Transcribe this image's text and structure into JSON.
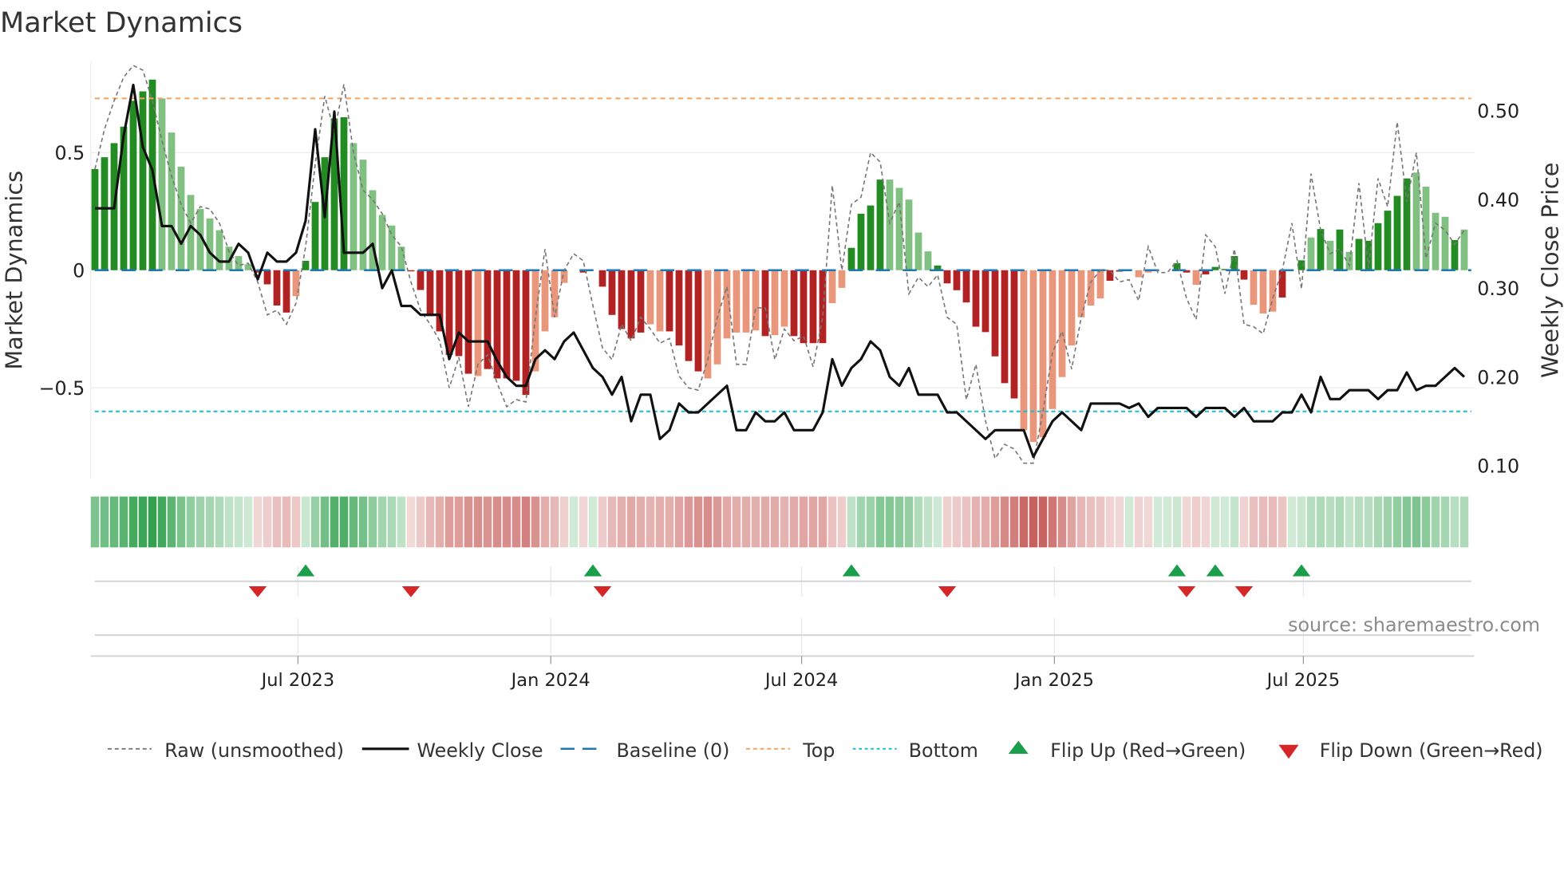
{
  "title": "Market Dynamics",
  "source": "source: sharemaestro.com",
  "chart_data": {
    "type": "bar",
    "title": "Market Dynamics",
    "ylabel": "Market Dynamics",
    "y2label": "Weekly Close Price",
    "ylim": [
      -0.886,
      0.886
    ],
    "y2lim": [
      0.085,
      0.555
    ],
    "yticks": [
      {
        "v": 0.5,
        "label": "0.5"
      },
      {
        "v": 0,
        "label": "0"
      },
      {
        "v": -0.5,
        "label": "−0.5"
      }
    ],
    "y2ticks": [
      {
        "v": 0.5,
        "label": "0.50"
      },
      {
        "v": 0.4,
        "label": "0.40"
      },
      {
        "v": 0.3,
        "label": "0.30"
      },
      {
        "v": 0.2,
        "label": "0.20"
      },
      {
        "v": 0.1,
        "label": "0.10"
      }
    ],
    "xticks": [
      {
        "week": 22.2,
        "label": "Jul 2023"
      },
      {
        "week": 48.6,
        "label": "Jan 2024"
      },
      {
        "week": 74.8,
        "label": "Jul 2024"
      },
      {
        "week": 101.2,
        "label": "Jan 2025"
      },
      {
        "week": 127.2,
        "label": "Jul 2025"
      }
    ],
    "top": 0.73,
    "bottom": -0.6,
    "baseline": 0,
    "values": [
      0.43,
      0.48,
      0.54,
      0.61,
      0.72,
      0.76,
      0.81,
      0.73,
      0.585,
      0.44,
      0.32,
      0.26,
      0.22,
      0.17,
      0.1,
      0.06,
      0.025,
      -0.01,
      -0.06,
      -0.15,
      -0.18,
      -0.11,
      0.04,
      0.29,
      0.48,
      0.645,
      0.65,
      0.54,
      0.47,
      0.34,
      0.235,
      0.19,
      0.1,
      -0.005,
      -0.084,
      -0.195,
      -0.26,
      -0.36,
      -0.365,
      -0.44,
      -0.45,
      -0.42,
      -0.46,
      -0.46,
      -0.47,
      -0.53,
      -0.43,
      -0.26,
      -0.2,
      -0.054,
      0,
      -0.01,
      0,
      -0.07,
      -0.19,
      -0.25,
      -0.29,
      -0.265,
      -0.23,
      -0.26,
      -0.26,
      -0.32,
      -0.386,
      -0.43,
      -0.46,
      -0.4,
      -0.29,
      -0.265,
      -0.265,
      -0.256,
      -0.28,
      -0.276,
      -0.24,
      -0.28,
      -0.31,
      -0.31,
      -0.31,
      -0.14,
      -0.075,
      0.095,
      0.24,
      0.275,
      0.385,
      0.385,
      0.35,
      0.3,
      0.16,
      0.08,
      0.02,
      -0.056,
      -0.085,
      -0.137,
      -0.24,
      -0.263,
      -0.366,
      -0.48,
      -0.545,
      -0.68,
      -0.73,
      -0.71,
      -0.59,
      -0.454,
      -0.32,
      -0.2,
      -0.15,
      -0.12,
      -0.045,
      -0.006,
      0,
      -0.03,
      -0.01,
      0,
      0,
      0.03,
      -0.01,
      -0.062,
      -0.018,
      0.014,
      0.005,
      0.06,
      -0.04,
      -0.147,
      -0.184,
      -0.176,
      -0.116,
      0,
      0.042,
      0.139,
      0.175,
      0.125,
      0.173,
      0.078,
      0.133,
      0.125,
      0.2,
      0.253,
      0.316,
      0.39,
      0.415,
      0.355,
      0.244,
      0.227,
      0.128,
      0.173
    ],
    "strength": "dddddddllllllllllddddldddddlllllldddddddldddddllllldddddddllddddlllllldllddddllddddllllldddddddddlllllllllddlllddddldddddllldddldldlddddddlllld",
    "raw": [
      0.43,
      0.6,
      0.72,
      0.82,
      0.87,
      0.85,
      0.72,
      0.55,
      0.4,
      0.28,
      0.2,
      0.27,
      0.26,
      0.2,
      0.08,
      0.02,
      0.03,
      -0.05,
      -0.19,
      -0.17,
      -0.23,
      -0.14,
      0.1,
      0.45,
      0.74,
      0.59,
      0.79,
      0.5,
      0.34,
      0.3,
      0.24,
      0.15,
      0.1,
      -0.05,
      -0.17,
      -0.23,
      -0.3,
      -0.5,
      -0.37,
      -0.58,
      -0.4,
      -0.36,
      -0.48,
      -0.58,
      -0.55,
      -0.56,
      -0.2,
      0.09,
      -0.2,
      0.0,
      0.07,
      0.04,
      -0.15,
      -0.33,
      -0.38,
      -0.23,
      -0.3,
      -0.2,
      -0.25,
      -0.31,
      -0.29,
      -0.45,
      -0.5,
      -0.51,
      -0.38,
      -0.2,
      -0.07,
      -0.4,
      -0.4,
      -0.16,
      -0.16,
      -0.38,
      -0.25,
      -0.3,
      -0.28,
      -0.41,
      -0.2,
      0.36,
      0.0,
      0.28,
      0.31,
      0.5,
      0.46,
      0.2,
      0.29,
      -0.1,
      -0.03,
      -0.07,
      -0.02,
      -0.2,
      -0.23,
      -0.55,
      -0.4,
      -0.64,
      -0.8,
      -0.74,
      -0.76,
      -0.82,
      -0.82,
      -0.6,
      -0.35,
      -0.26,
      -0.42,
      -0.2,
      -0.05,
      0.0,
      0.0,
      -0.05,
      -0.04,
      -0.13,
      0.1,
      -0.01,
      -0.01,
      0.04,
      -0.12,
      -0.21,
      0.15,
      0.1,
      -0.1,
      0.09,
      -0.23,
      -0.24,
      -0.27,
      -0.12,
      0.0,
      0.2,
      -0.08,
      0.41,
      0.17,
      0.07,
      0.09,
      0.02,
      0.37,
      0.01,
      0.39,
      0.27,
      0.63,
      0.29,
      0.5,
      0.05,
      0.2,
      0.17,
      0.11,
      0.17
    ],
    "close": [
      0.39,
      0.39,
      0.39,
      0.472,
      0.529,
      0.459,
      0.433,
      0.37,
      0.37,
      0.35,
      0.37,
      0.36,
      0.34,
      0.33,
      0.33,
      0.35,
      0.34,
      0.31,
      0.34,
      0.33,
      0.33,
      0.34,
      0.376,
      0.479,
      0.38,
      0.499,
      0.34,
      0.34,
      0.34,
      0.35,
      0.3,
      0.32,
      0.28,
      0.28,
      0.27,
      0.27,
      0.27,
      0.22,
      0.25,
      0.24,
      0.24,
      0.24,
      0.218,
      0.2,
      0.19,
      0.19,
      0.22,
      0.23,
      0.22,
      0.24,
      0.25,
      0.23,
      0.21,
      0.2,
      0.18,
      0.2,
      0.15,
      0.18,
      0.18,
      0.13,
      0.14,
      0.17,
      0.16,
      0.16,
      0.17,
      0.18,
      0.19,
      0.14,
      0.14,
      0.16,
      0.15,
      0.15,
      0.16,
      0.14,
      0.14,
      0.14,
      0.16,
      0.22,
      0.19,
      0.21,
      0.22,
      0.24,
      0.23,
      0.2,
      0.19,
      0.21,
      0.18,
      0.18,
      0.18,
      0.16,
      0.16,
      0.15,
      0.14,
      0.13,
      0.14,
      0.14,
      0.14,
      0.14,
      0.11,
      0.13,
      0.15,
      0.16,
      0.15,
      0.14,
      0.17,
      0.17,
      0.17,
      0.17,
      0.165,
      0.17,
      0.155,
      0.165,
      0.165,
      0.165,
      0.165,
      0.155,
      0.165,
      0.165,
      0.165,
      0.155,
      0.165,
      0.15,
      0.15,
      0.15,
      0.16,
      0.16,
      0.18,
      0.16,
      0.2,
      0.175,
      0.175,
      0.185,
      0.185,
      0.185,
      0.175,
      0.185,
      0.185,
      0.205,
      0.185,
      0.19,
      0.19,
      0.2,
      0.21,
      0.2
    ],
    "flip_up_weeks": [
      23,
      53,
      80,
      114,
      118,
      127
    ],
    "flip_down_weeks": [
      18,
      34,
      54,
      90,
      115,
      121
    ],
    "legend": [
      {
        "key": "raw",
        "label": "Raw (unsmoothed)"
      },
      {
        "key": "close",
        "label": "Weekly Close"
      },
      {
        "key": "baseline",
        "label": "Baseline (0)"
      },
      {
        "key": "top",
        "label": "Top"
      },
      {
        "key": "bottom",
        "label": "Bottom"
      },
      {
        "key": "flip_up",
        "label": "Flip Up (Red→Green)"
      },
      {
        "key": "flip_down",
        "label": "Flip Down (Green→Red)"
      }
    ],
    "legend_placement": "bottom",
    "colors": {
      "pos_strong": "#228b22",
      "pos_fading": "#80c080",
      "neg_strong": "#b22222",
      "neg_fading": "#e9967a",
      "raw": "#777777",
      "close": "#111111",
      "baseline": "#1f77b4",
      "top": "#f4a460",
      "bottom": "#17becf",
      "flip_up": "#1a9e4a",
      "flip_down": "#d62728"
    }
  }
}
